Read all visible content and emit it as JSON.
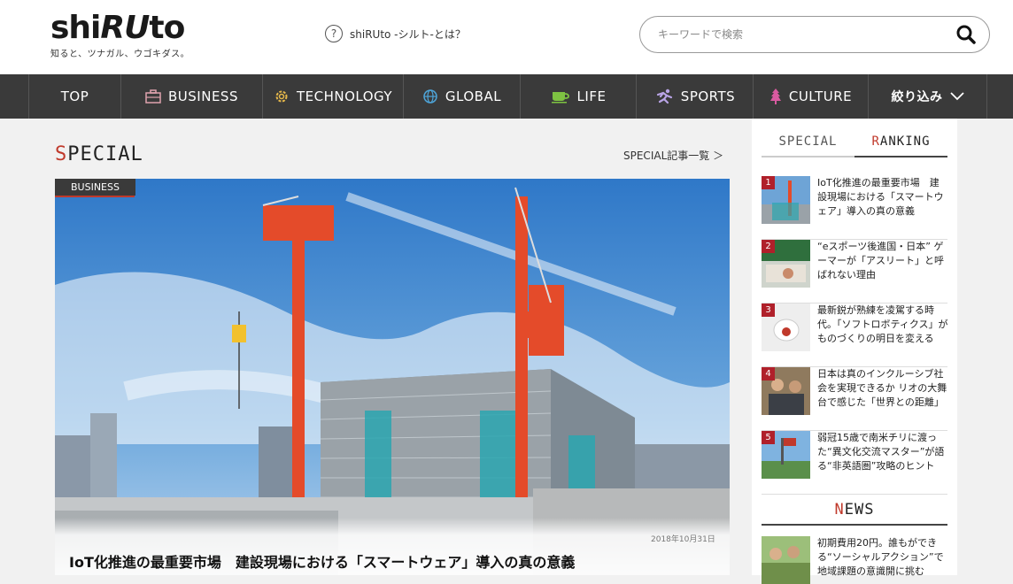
{
  "header": {
    "logo_text_a": "shi",
    "logo_text_b": "RU",
    "logo_text_c": "to",
    "tagline": "知ると、ツナガル、ウゴキダス。",
    "about_icon": "question-circle-icon",
    "about_label": "shiRUto -シルト-とは？",
    "search_placeholder": "キーワードで検索",
    "search_icon": "search-icon"
  },
  "nav": {
    "items": [
      {
        "label": "TOP",
        "icon": ""
      },
      {
        "label": "BUSINESS",
        "icon": "briefcase-icon"
      },
      {
        "label": "TECHNOLOGY",
        "icon": "gear-icon"
      },
      {
        "label": "GLOBAL",
        "icon": "globe-icon"
      },
      {
        "label": "LIFE",
        "icon": "cup-icon"
      },
      {
        "label": "SPORTS",
        "icon": "runner-icon"
      },
      {
        "label": "CULTURE",
        "icon": "tree-icon"
      },
      {
        "label": "絞り込み",
        "icon": "chevron-down-icon"
      }
    ]
  },
  "main": {
    "section_first": "S",
    "section_rest": "PECIAL",
    "list_link": "SPECIAL記事一覧 ＞",
    "hero": {
      "category": "BUSINESS",
      "date": "2018年10月31日",
      "title": "IoT化推進の最重要市場　建設現場における「スマートウェア」導入の真の意義"
    }
  },
  "sidebar": {
    "tabs": [
      {
        "first": "",
        "rest": "SPECIAL"
      },
      {
        "first": "R",
        "rest": "ANKING"
      }
    ],
    "ranking": [
      {
        "rank": "1",
        "title": "IoT化推進の最重要市場　建設現場における「スマートウェア」導入の真の意義"
      },
      {
        "rank": "2",
        "title": "“eスポーツ後進国・日本” ゲーマーが「アスリート」と呼ばれない理由"
      },
      {
        "rank": "3",
        "title": "最新鋭が熟練を凌駕する時代。「ソフトロボティクス」がものづくりの明日を変える"
      },
      {
        "rank": "4",
        "title": "日本は真のインクルーシブ社会を実現できるか リオの大舞台で感じた「世界との距離」"
      },
      {
        "rank": "5",
        "title": "弱冠15歳で南米チリに渡った“異文化交流マスター”が語る“非英語圏”攻略のヒント"
      }
    ],
    "news_first": "N",
    "news_rest": "EWS",
    "news": [
      {
        "title": "初期費用20円。誰もができる“ソーシャルアクション”で地域課題の意識開に挑む"
      }
    ]
  },
  "colors": {
    "accent": "#c0392b",
    "nav_bg": "#3a3a3a",
    "rank_badge": "#b0202a"
  }
}
